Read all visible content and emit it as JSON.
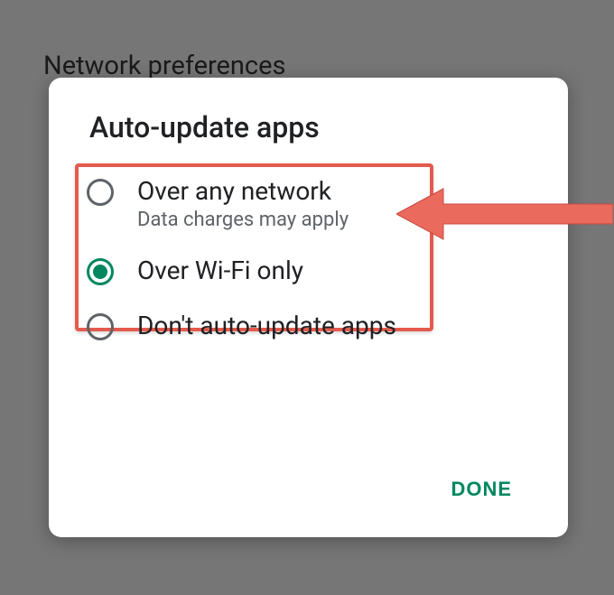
{
  "background": {
    "title": "Network preferences"
  },
  "dialog": {
    "title": "Auto-update apps",
    "options": [
      {
        "label": "Over any network",
        "sublabel": "Data charges may apply",
        "selected": false
      },
      {
        "label": "Over Wi-Fi only",
        "sublabel": "",
        "selected": true
      },
      {
        "label": "Don't auto-update apps",
        "sublabel": "",
        "selected": false
      }
    ],
    "done_label": "DONE"
  },
  "annotation": {
    "highlight_color": "#e45b4d",
    "arrow_color": "#e45b4d"
  }
}
